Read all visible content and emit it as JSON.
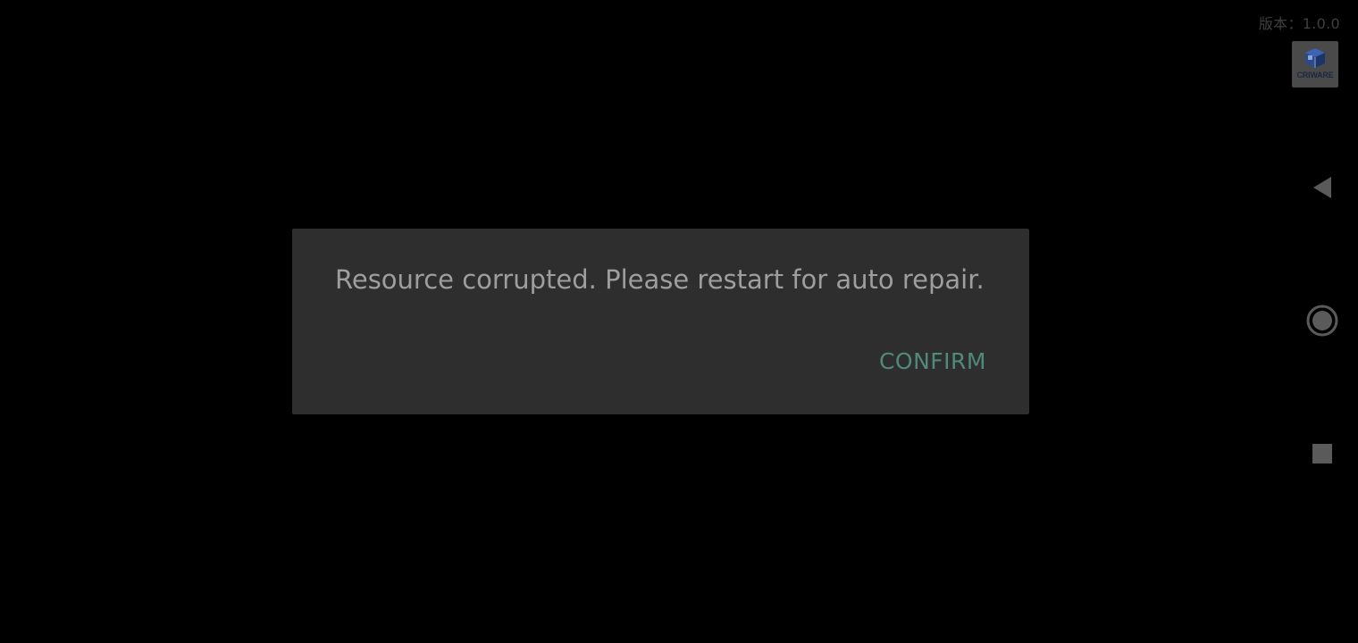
{
  "status": {
    "version_text": "版本：1.0.0"
  },
  "logo": {
    "name": "criware-logo",
    "text": "CRIWARE"
  },
  "dialog": {
    "message": "Resource corrupted. Please restart for auto repair.",
    "confirm_label": "CONFIRM"
  },
  "navigation": {
    "back_icon": "back-triangle-icon",
    "home_icon": "home-circle-icon",
    "recents_icon": "recents-square-icon"
  },
  "colors": {
    "background": "#000000",
    "dialog_background": "#2e2e2e",
    "message_text": "#9e9e9e",
    "confirm_accent": "#4f8a7a",
    "nav_icon": "#5a5a5a",
    "version_text": "#3f3f3f"
  }
}
